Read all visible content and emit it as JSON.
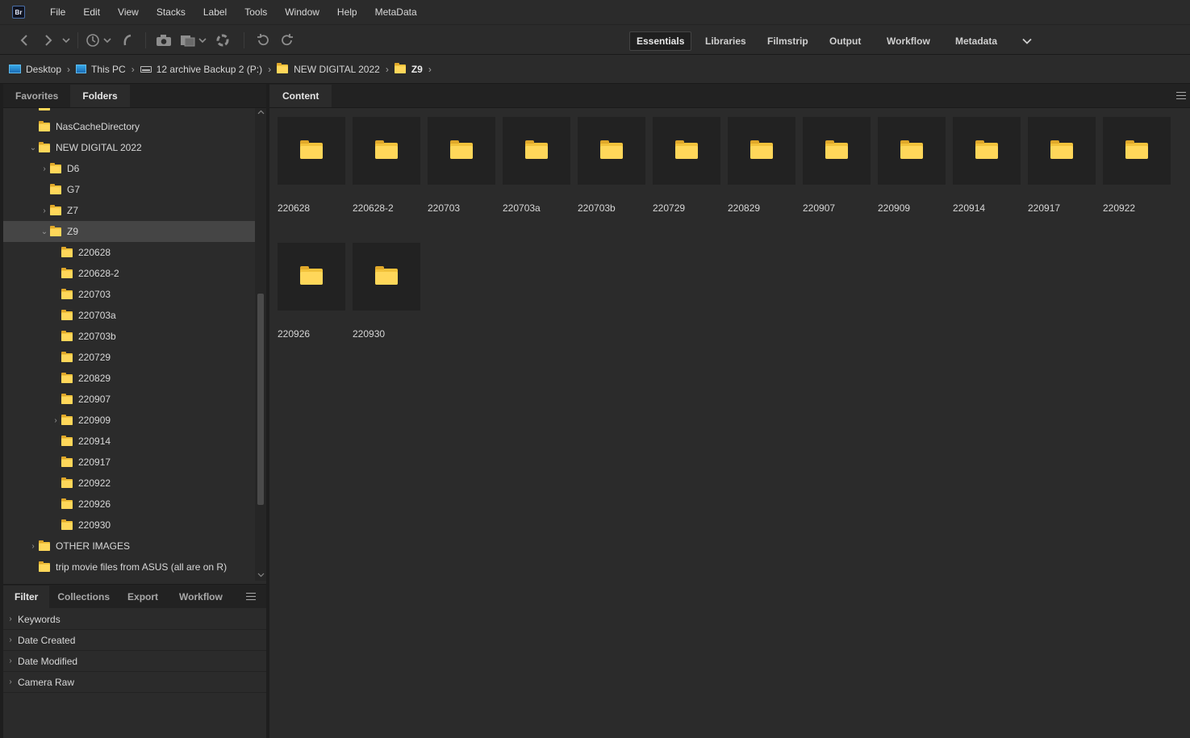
{
  "app": {
    "logo": "Br"
  },
  "menu": [
    "File",
    "Edit",
    "View",
    "Stacks",
    "Label",
    "Tools",
    "Window",
    "Help",
    "MetaData"
  ],
  "toolbar": {
    "icons": [
      "back-arrow-icon",
      "forward-arrow-icon",
      "dropdown-chevron-icon",
      "recent-history-icon",
      "boomerang-icon",
      "camera-get-photos-icon",
      "copy-files-icon",
      "refine-icon",
      "rotate-left-icon",
      "rotate-right-icon"
    ],
    "workspaces": [
      "Essentials",
      "Libraries",
      "Filmstrip",
      "Output",
      "Workflow",
      "Metadata"
    ],
    "active_workspace": "Essentials"
  },
  "breadcrumb": [
    {
      "label": "Desktop",
      "icon": "desktop-icon"
    },
    {
      "label": "This PC",
      "icon": "computer-icon"
    },
    {
      "label": "12 archive Backup 2 (P:)",
      "icon": "drive-icon"
    },
    {
      "label": "NEW DIGITAL 2022",
      "icon": "folder-icon"
    },
    {
      "label": "Z9",
      "icon": "folder-icon"
    }
  ],
  "left_tabs": [
    "Favorites",
    "Folders"
  ],
  "active_left_tab": "Folders",
  "tree": [
    {
      "label": "NasCacheDirectory",
      "depth": 0,
      "chevron": ""
    },
    {
      "label": "NEW DIGITAL 2022",
      "depth": 0,
      "chevron": "⌄"
    },
    {
      "label": "D6",
      "depth": 1,
      "chevron": "›"
    },
    {
      "label": "G7",
      "depth": 1,
      "chevron": ""
    },
    {
      "label": "Z7",
      "depth": 1,
      "chevron": "›"
    },
    {
      "label": "Z9",
      "depth": 1,
      "chevron": "⌄",
      "selected": true
    },
    {
      "label": "220628",
      "depth": 2,
      "chevron": ""
    },
    {
      "label": "220628-2",
      "depth": 2,
      "chevron": ""
    },
    {
      "label": "220703",
      "depth": 2,
      "chevron": ""
    },
    {
      "label": "220703a",
      "depth": 2,
      "chevron": ""
    },
    {
      "label": "220703b",
      "depth": 2,
      "chevron": ""
    },
    {
      "label": "220729",
      "depth": 2,
      "chevron": ""
    },
    {
      "label": "220829",
      "depth": 2,
      "chevron": ""
    },
    {
      "label": "220907",
      "depth": 2,
      "chevron": ""
    },
    {
      "label": "220909",
      "depth": 2,
      "chevron": "›"
    },
    {
      "label": "220914",
      "depth": 2,
      "chevron": ""
    },
    {
      "label": "220917",
      "depth": 2,
      "chevron": ""
    },
    {
      "label": "220922",
      "depth": 2,
      "chevron": ""
    },
    {
      "label": "220926",
      "depth": 2,
      "chevron": ""
    },
    {
      "label": "220930",
      "depth": 2,
      "chevron": ""
    },
    {
      "label": "OTHER IMAGES",
      "depth": 0,
      "chevron": "›"
    },
    {
      "label": "trip movie files from ASUS (all are on R)",
      "depth": 0,
      "chevron": ""
    }
  ],
  "bottom_tabs": [
    "Filter",
    "Collections",
    "Export",
    "Workflow"
  ],
  "active_bottom_tab": "Filter",
  "filters": [
    "Keywords",
    "Date Created",
    "Date Modified",
    "Camera Raw"
  ],
  "content_tab": "Content",
  "content_items": [
    "220628",
    "220628-2",
    "220703",
    "220703a",
    "220703b",
    "220729",
    "220829",
    "220907",
    "220909",
    "220914",
    "220917",
    "220922",
    "220926",
    "220930"
  ]
}
